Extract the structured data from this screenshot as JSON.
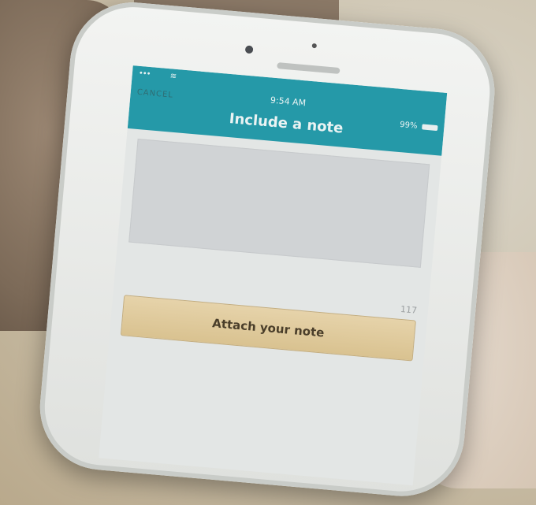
{
  "status_bar": {
    "time": "9:54 AM",
    "battery_percent": "99%",
    "signal": "•••",
    "wifi_icon": "wifi-icon"
  },
  "nav": {
    "cancel_label": "CANCEL",
    "title": "Include a note"
  },
  "note": {
    "value": "",
    "remaining_chars": "117"
  },
  "attach_button": {
    "label": "Attach your note"
  },
  "colors": {
    "nav_bar": "#2599a8",
    "button": "#dcc696",
    "background": "#e3e6e5"
  }
}
